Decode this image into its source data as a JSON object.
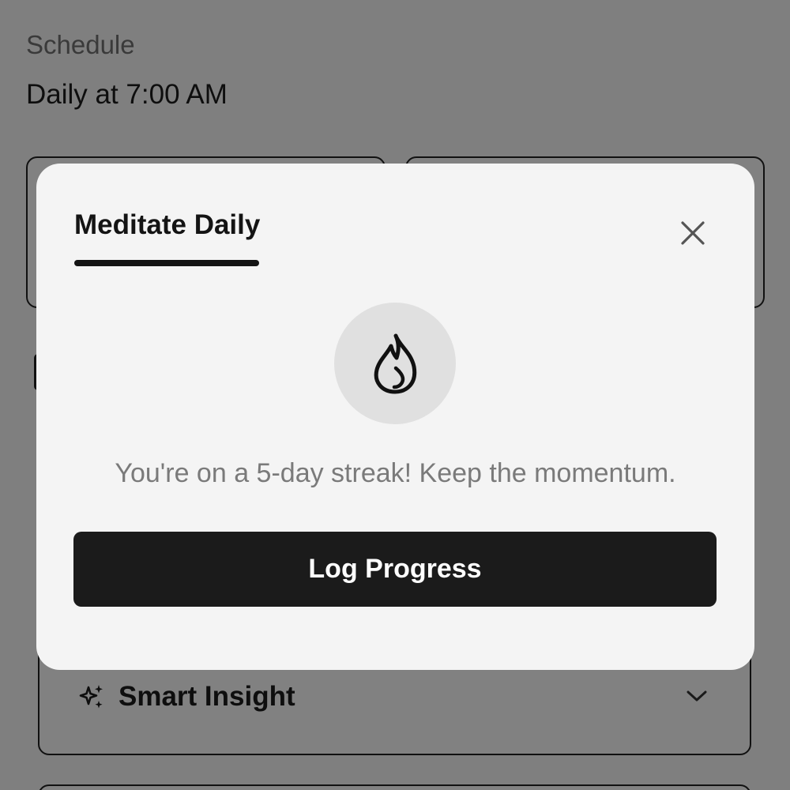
{
  "background": {
    "schedule_label": "Schedule",
    "schedule_value": "Daily at 7:00 AM",
    "insight": {
      "title": "Smart Insight",
      "icon": "sparkles-icon",
      "chevron_icon": "chevron-down-icon"
    }
  },
  "modal": {
    "tab_label": "Meditate Daily",
    "close_icon": "close-icon",
    "streak_icon": "flame-icon",
    "message": "You're on a 5-day streak! Keep the momentum.",
    "button_label": "Log Progress"
  },
  "colors": {
    "button_background": "#1b1b1b",
    "modal_background": "#f4f4f4",
    "icon_circle": "#e0e0e0",
    "message_text": "#7a7a7a"
  }
}
